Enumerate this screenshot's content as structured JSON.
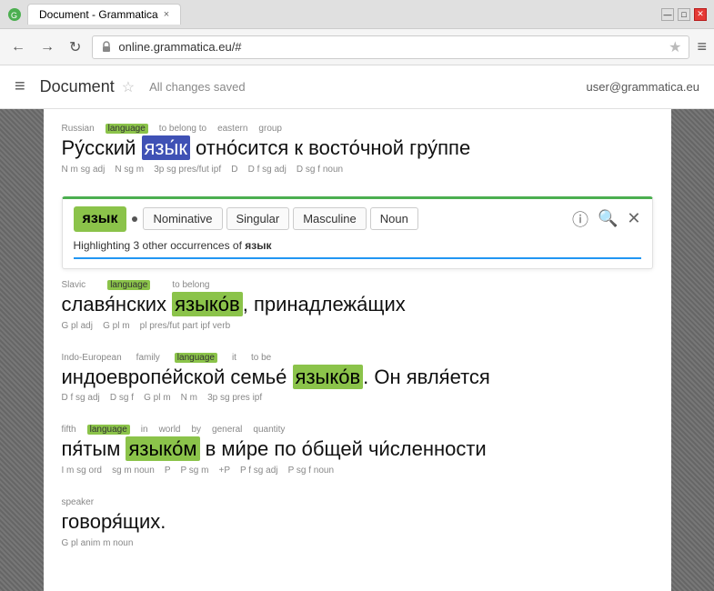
{
  "browser": {
    "title": "Document - Grammatica",
    "tab_label": "Document - Grammatica",
    "url": "online.grammatica.eu/#",
    "close_label": "×",
    "window_min": "—",
    "window_max": "□",
    "window_close": "✕"
  },
  "app": {
    "hamburger": "≡",
    "doc_title": "Document",
    "star": "☆",
    "saved_status": "All changes saved",
    "user_email": "user@grammatica.eu"
  },
  "popup": {
    "word": "язык",
    "pills": [
      "Nominative",
      "Singular",
      "Masculine",
      "Noun"
    ],
    "highlight_text": "Highlighting 3 other occurrences of ",
    "highlight_word": "язык"
  },
  "sentences": [
    {
      "id": "s1",
      "annotations_top": [
        {
          "label": "Russian",
          "offset": 0
        },
        {
          "label": "language",
          "offset": 1,
          "highlight": true
        },
        {
          "label": "to belong to",
          "offset": 2
        },
        {
          "label": "eastern",
          "offset": 3
        },
        {
          "label": "group",
          "offset": 4
        }
      ],
      "words": [
        {
          "text": "Ру́сский",
          "gram_top": "",
          "gram_bot": "N m sg adj"
        },
        {
          "text": "язы́к",
          "gram_top": "",
          "gram_bot": "N sg m",
          "box": "blue"
        },
        {
          "text": "отно́сится",
          "gram_top": "",
          "gram_bot": "3p sg pres/fut ipf"
        },
        {
          "text": "к",
          "gram_top": "",
          "gram_bot": "D"
        },
        {
          "text": "восто́чной",
          "gram_top": "",
          "gram_bot": "D f sg adj"
        },
        {
          "text": "гру́ппе",
          "gram_top": "",
          "gram_bot": "D sg f noun"
        }
      ],
      "text": "Ру́сский язы́к отно́сится к восто́чной гру́ппе"
    },
    {
      "id": "s2",
      "text": "славя́нских языко́в, принадлежа́щих",
      "annotations_top": [
        {
          "label": "Slavic"
        },
        {
          "label": "language",
          "highlight": true
        }
      ],
      "words": [
        {
          "text": "славя́нских",
          "gram_bot": "G pl adj"
        },
        {
          "text": "языко́в,",
          "gram_bot": "G pl m",
          "box": "green"
        },
        {
          "text": "принадлежа́щих",
          "gram_bot": "pl pres/fut part ipf verb"
        }
      ]
    },
    {
      "id": "s3",
      "text": "индоевропе́йской семье́ языко́в. Он явля́ется",
      "annotations_top": [
        {
          "label": "Indo-European"
        },
        {
          "label": "family"
        },
        {
          "label": "language",
          "highlight": true
        },
        {
          "label": "it"
        },
        {
          "label": "to be"
        }
      ],
      "words": [
        {
          "text": "индоевропе́йской",
          "gram_bot": "D f sg adj"
        },
        {
          "text": "семье́",
          "gram_bot": "D sg f"
        },
        {
          "text": "языко́в.",
          "gram_bot": "G pl m",
          "box": "green"
        },
        {
          "text": "Он",
          "gram_bot": "N m"
        },
        {
          "text": "явля́ется",
          "gram_bot": "3p sg pres ipf"
        }
      ]
    },
    {
      "id": "s4",
      "text": "пя́тым языко́м в ми́ре по о́бщей чи́сленности",
      "annotations_top": [
        {
          "label": "fifth"
        },
        {
          "label": "language",
          "highlight": true
        },
        {
          "label": "in"
        },
        {
          "label": "world"
        },
        {
          "label": "by"
        },
        {
          "label": "general"
        },
        {
          "label": "quantity"
        }
      ],
      "words": [
        {
          "text": "пя́тым",
          "gram_bot": "I m sg ord"
        },
        {
          "text": "языко́м",
          "gram_bot": "sg m noun",
          "box": "green"
        },
        {
          "text": "в",
          "gram_bot": "P"
        },
        {
          "text": "ми́ре",
          "gram_bot": "P sg m"
        },
        {
          "text": "по",
          "gram_bot": "+P"
        },
        {
          "text": "о́бщей",
          "gram_bot": "P f sg adj"
        },
        {
          "text": "чи́сленности",
          "gram_bot": "P sg f noun"
        }
      ]
    },
    {
      "id": "s5",
      "text": "говоря́щих.",
      "annotations_top": [
        {
          "label": "speaker"
        }
      ],
      "words": [
        {
          "text": "говоря́щих.",
          "gram_bot": "G pl anim m noun"
        }
      ]
    }
  ]
}
